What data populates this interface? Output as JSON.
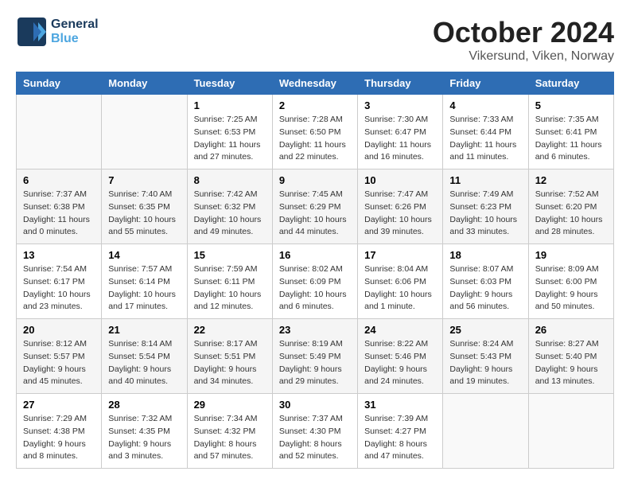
{
  "logo": {
    "line1": "General",
    "line2": "Blue"
  },
  "title": "October 2024",
  "subtitle": "Vikersund, Viken, Norway",
  "weekdays": [
    "Sunday",
    "Monday",
    "Tuesday",
    "Wednesday",
    "Thursday",
    "Friday",
    "Saturday"
  ],
  "weeks": [
    [
      {
        "day": "",
        "sunrise": "",
        "sunset": "",
        "daylight": ""
      },
      {
        "day": "",
        "sunrise": "",
        "sunset": "",
        "daylight": ""
      },
      {
        "day": "1",
        "sunrise": "Sunrise: 7:25 AM",
        "sunset": "Sunset: 6:53 PM",
        "daylight": "Daylight: 11 hours and 27 minutes."
      },
      {
        "day": "2",
        "sunrise": "Sunrise: 7:28 AM",
        "sunset": "Sunset: 6:50 PM",
        "daylight": "Daylight: 11 hours and 22 minutes."
      },
      {
        "day": "3",
        "sunrise": "Sunrise: 7:30 AM",
        "sunset": "Sunset: 6:47 PM",
        "daylight": "Daylight: 11 hours and 16 minutes."
      },
      {
        "day": "4",
        "sunrise": "Sunrise: 7:33 AM",
        "sunset": "Sunset: 6:44 PM",
        "daylight": "Daylight: 11 hours and 11 minutes."
      },
      {
        "day": "5",
        "sunrise": "Sunrise: 7:35 AM",
        "sunset": "Sunset: 6:41 PM",
        "daylight": "Daylight: 11 hours and 6 minutes."
      }
    ],
    [
      {
        "day": "6",
        "sunrise": "Sunrise: 7:37 AM",
        "sunset": "Sunset: 6:38 PM",
        "daylight": "Daylight: 11 hours and 0 minutes."
      },
      {
        "day": "7",
        "sunrise": "Sunrise: 7:40 AM",
        "sunset": "Sunset: 6:35 PM",
        "daylight": "Daylight: 10 hours and 55 minutes."
      },
      {
        "day": "8",
        "sunrise": "Sunrise: 7:42 AM",
        "sunset": "Sunset: 6:32 PM",
        "daylight": "Daylight: 10 hours and 49 minutes."
      },
      {
        "day": "9",
        "sunrise": "Sunrise: 7:45 AM",
        "sunset": "Sunset: 6:29 PM",
        "daylight": "Daylight: 10 hours and 44 minutes."
      },
      {
        "day": "10",
        "sunrise": "Sunrise: 7:47 AM",
        "sunset": "Sunset: 6:26 PM",
        "daylight": "Daylight: 10 hours and 39 minutes."
      },
      {
        "day": "11",
        "sunrise": "Sunrise: 7:49 AM",
        "sunset": "Sunset: 6:23 PM",
        "daylight": "Daylight: 10 hours and 33 minutes."
      },
      {
        "day": "12",
        "sunrise": "Sunrise: 7:52 AM",
        "sunset": "Sunset: 6:20 PM",
        "daylight": "Daylight: 10 hours and 28 minutes."
      }
    ],
    [
      {
        "day": "13",
        "sunrise": "Sunrise: 7:54 AM",
        "sunset": "Sunset: 6:17 PM",
        "daylight": "Daylight: 10 hours and 23 minutes."
      },
      {
        "day": "14",
        "sunrise": "Sunrise: 7:57 AM",
        "sunset": "Sunset: 6:14 PM",
        "daylight": "Daylight: 10 hours and 17 minutes."
      },
      {
        "day": "15",
        "sunrise": "Sunrise: 7:59 AM",
        "sunset": "Sunset: 6:11 PM",
        "daylight": "Daylight: 10 hours and 12 minutes."
      },
      {
        "day": "16",
        "sunrise": "Sunrise: 8:02 AM",
        "sunset": "Sunset: 6:09 PM",
        "daylight": "Daylight: 10 hours and 6 minutes."
      },
      {
        "day": "17",
        "sunrise": "Sunrise: 8:04 AM",
        "sunset": "Sunset: 6:06 PM",
        "daylight": "Daylight: 10 hours and 1 minute."
      },
      {
        "day": "18",
        "sunrise": "Sunrise: 8:07 AM",
        "sunset": "Sunset: 6:03 PM",
        "daylight": "Daylight: 9 hours and 56 minutes."
      },
      {
        "day": "19",
        "sunrise": "Sunrise: 8:09 AM",
        "sunset": "Sunset: 6:00 PM",
        "daylight": "Daylight: 9 hours and 50 minutes."
      }
    ],
    [
      {
        "day": "20",
        "sunrise": "Sunrise: 8:12 AM",
        "sunset": "Sunset: 5:57 PM",
        "daylight": "Daylight: 9 hours and 45 minutes."
      },
      {
        "day": "21",
        "sunrise": "Sunrise: 8:14 AM",
        "sunset": "Sunset: 5:54 PM",
        "daylight": "Daylight: 9 hours and 40 minutes."
      },
      {
        "day": "22",
        "sunrise": "Sunrise: 8:17 AM",
        "sunset": "Sunset: 5:51 PM",
        "daylight": "Daylight: 9 hours and 34 minutes."
      },
      {
        "day": "23",
        "sunrise": "Sunrise: 8:19 AM",
        "sunset": "Sunset: 5:49 PM",
        "daylight": "Daylight: 9 hours and 29 minutes."
      },
      {
        "day": "24",
        "sunrise": "Sunrise: 8:22 AM",
        "sunset": "Sunset: 5:46 PM",
        "daylight": "Daylight: 9 hours and 24 minutes."
      },
      {
        "day": "25",
        "sunrise": "Sunrise: 8:24 AM",
        "sunset": "Sunset: 5:43 PM",
        "daylight": "Daylight: 9 hours and 19 minutes."
      },
      {
        "day": "26",
        "sunrise": "Sunrise: 8:27 AM",
        "sunset": "Sunset: 5:40 PM",
        "daylight": "Daylight: 9 hours and 13 minutes."
      }
    ],
    [
      {
        "day": "27",
        "sunrise": "Sunrise: 7:29 AM",
        "sunset": "Sunset: 4:38 PM",
        "daylight": "Daylight: 9 hours and 8 minutes."
      },
      {
        "day": "28",
        "sunrise": "Sunrise: 7:32 AM",
        "sunset": "Sunset: 4:35 PM",
        "daylight": "Daylight: 9 hours and 3 minutes."
      },
      {
        "day": "29",
        "sunrise": "Sunrise: 7:34 AM",
        "sunset": "Sunset: 4:32 PM",
        "daylight": "Daylight: 8 hours and 57 minutes."
      },
      {
        "day": "30",
        "sunrise": "Sunrise: 7:37 AM",
        "sunset": "Sunset: 4:30 PM",
        "daylight": "Daylight: 8 hours and 52 minutes."
      },
      {
        "day": "31",
        "sunrise": "Sunrise: 7:39 AM",
        "sunset": "Sunset: 4:27 PM",
        "daylight": "Daylight: 8 hours and 47 minutes."
      },
      {
        "day": "",
        "sunrise": "",
        "sunset": "",
        "daylight": ""
      },
      {
        "day": "",
        "sunrise": "",
        "sunset": "",
        "daylight": ""
      }
    ]
  ]
}
